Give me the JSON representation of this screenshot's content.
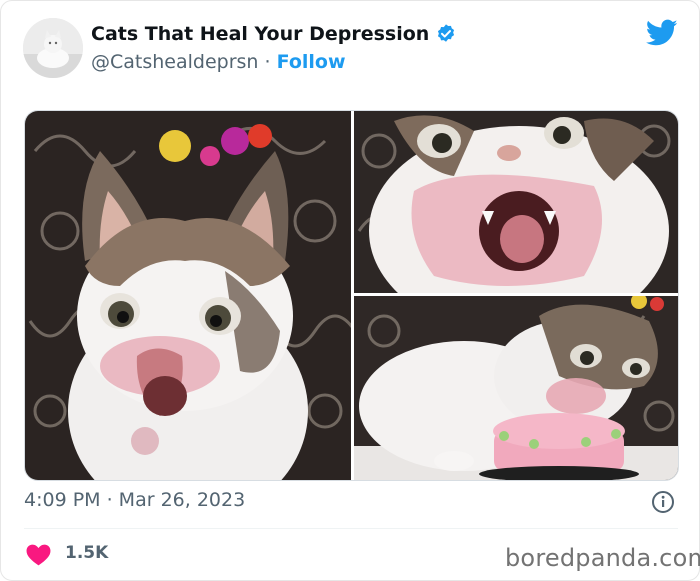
{
  "tweet": {
    "display_name": "Cats That Heal Your Depression",
    "handle": "@Catshealdeprsn",
    "separator": "·",
    "follow_label": "Follow",
    "timestamp": "4:09 PM · Mar 26, 2023",
    "likes": "1.5K"
  },
  "icons": {
    "verified": "verified-badge-icon",
    "platform": "twitter-bird-icon",
    "info": "info-icon",
    "like": "heart-icon"
  },
  "colors": {
    "accent": "#1d9bf0",
    "heart": "#f91880",
    "secondary_text": "#536471"
  },
  "watermark": "boredpanda.com"
}
